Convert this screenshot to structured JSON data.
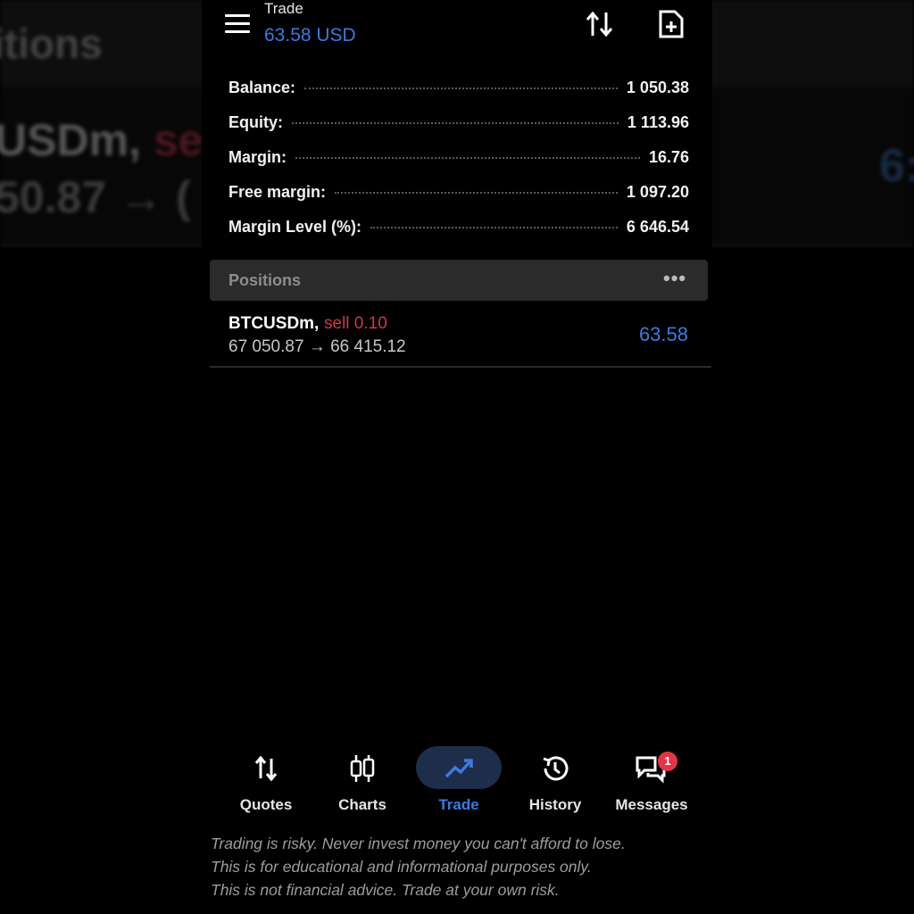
{
  "background": {
    "title": "itions",
    "symbol": "USDm,",
    "side": "sell",
    "price": "50.87",
    "arrow": "→",
    "price_rest": "(",
    "profit": "6:"
  },
  "header": {
    "title": "Trade",
    "subtitle": "63.58 USD",
    "menu_icon": "menu-icon",
    "sort_icon": "sort-icon",
    "new_order_icon": "new-order-icon"
  },
  "summary": [
    {
      "label": "Balance:",
      "value": "1 050.38"
    },
    {
      "label": "Equity:",
      "value": "1 113.96"
    },
    {
      "label": "Margin:",
      "value": "16.76"
    },
    {
      "label": "Free margin:",
      "value": "1 097.20"
    },
    {
      "label": "Margin Level (%):",
      "value": "6 646.54"
    }
  ],
  "positions": {
    "header": "Positions",
    "more": "•••",
    "rows": [
      {
        "symbol": "BTCUSDm,",
        "side": "sell 0.10",
        "prices": "67 050.87 → 66 415.12",
        "profit": "63.58"
      }
    ]
  },
  "nav": {
    "items": [
      {
        "label": "Quotes",
        "icon": "quotes-icon"
      },
      {
        "label": "Charts",
        "icon": "charts-icon"
      },
      {
        "label": "Trade",
        "icon": "trade-icon",
        "active": true
      },
      {
        "label": "History",
        "icon": "history-icon"
      },
      {
        "label": "Messages",
        "icon": "messages-icon",
        "badge": "1"
      }
    ]
  },
  "disclaimer": [
    "Trading is risky. Never invest money you can't afford to lose.",
    "This is for educational and informational purposes only.",
    "This is not financial advice. Trade at your own risk."
  ],
  "colors": {
    "accent": "#3a7be0",
    "sell": "#d0364d",
    "badge": "#e53448",
    "background": "#000000",
    "section_header": "#2b2b2b"
  }
}
